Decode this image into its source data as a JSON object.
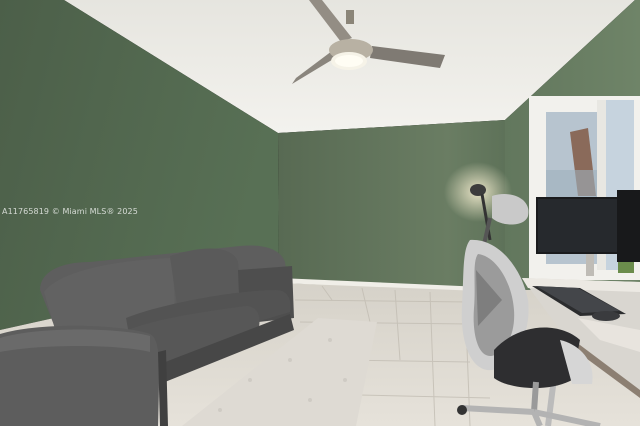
{
  "watermark": {
    "text": "A11765819 © Miami MLS® 2025"
  },
  "colors": {
    "wall_left": "#4f624c",
    "wall_back": "#5b6e56",
    "ceiling": "#ecebe6",
    "floor_tile": "#dcd8cf",
    "sofa": "#5a5a5a",
    "rug": "#e2ded8"
  },
  "objects": [
    "ceiling-fan",
    "sofa",
    "shag-rug",
    "office-chair",
    "desk",
    "monitor",
    "keyboard",
    "window",
    "desk-lamp"
  ]
}
